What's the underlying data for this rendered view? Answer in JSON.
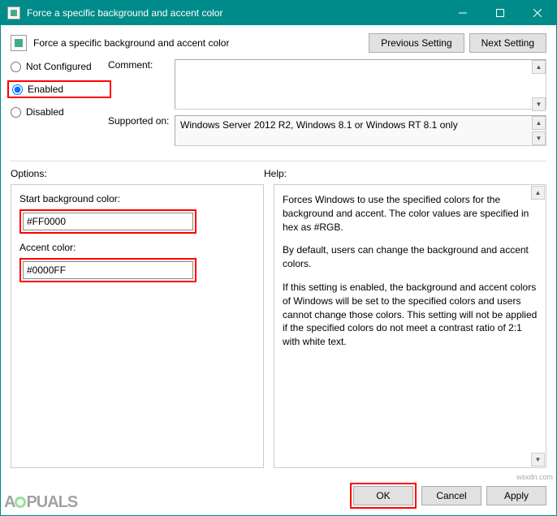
{
  "window": {
    "title": "Force a specific background and accent color"
  },
  "header": {
    "setting_name": "Force a specific background and accent color",
    "prev_btn": "Previous Setting",
    "next_btn": "Next Setting"
  },
  "radios": {
    "not_configured": "Not Configured",
    "enabled": "Enabled",
    "disabled": "Disabled"
  },
  "labels": {
    "comment": "Comment:",
    "supported": "Supported on:",
    "options": "Options:",
    "help": "Help:"
  },
  "supported_text": "Windows Server 2012 R2, Windows 8.1 or Windows RT 8.1 only",
  "options": {
    "bg_label": "Start background color:",
    "bg_value": "#FF0000",
    "accent_label": "Accent color:",
    "accent_value": "#0000FF"
  },
  "help": {
    "p1": "Forces Windows to use the specified colors for the background and accent. The color values are specified in hex as #RGB.",
    "p2": "By default, users can change the background and accent colors.",
    "p3": "If this setting is enabled, the background and accent colors of Windows will be set to the specified colors and users cannot change those colors. This setting will not be applied if the specified colors do not meet a contrast ratio of 2:1 with white text."
  },
  "footer": {
    "ok": "OK",
    "cancel": "Cancel",
    "apply": "Apply"
  },
  "watermark": {
    "brand_pre": "A",
    "brand_post": "PUALS",
    "src": "wsxdn.com"
  }
}
